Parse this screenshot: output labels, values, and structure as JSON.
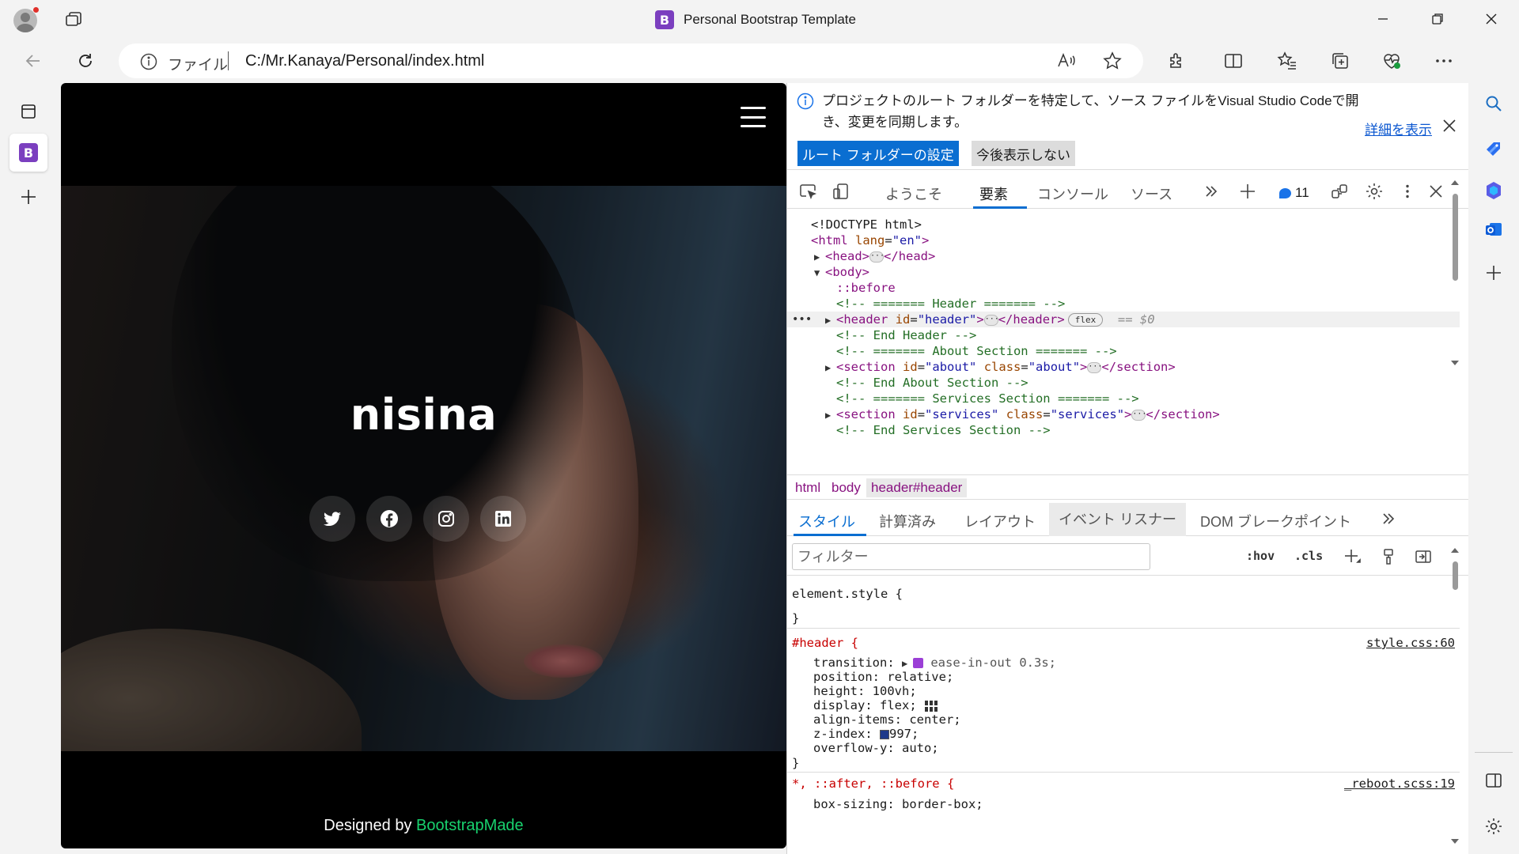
{
  "browser": {
    "tab_title": "Personal Bootstrap Template",
    "tab_logo_letter": "B",
    "address": {
      "scheme_label": "ファイル",
      "url": "C:/Mr.Kanaya/Personal/index.html"
    }
  },
  "page": {
    "site_name": "nisina",
    "socials": [
      "twitter-icon",
      "facebook-icon",
      "instagram-icon",
      "linkedin-icon"
    ],
    "credits_prefix": "Designed by",
    "credits_link": "BootstrapMade",
    "credits_link_color": "#18d26e"
  },
  "devtools": {
    "banner": {
      "message": "プロジェクトのルート フォルダーを特定して、ソース ファイルをVisual Studio Codeで開き、変更を同期します。",
      "learn_more": "詳細を表示",
      "primary_button": "ルート フォルダーの設定",
      "secondary_button": "今後表示しない"
    },
    "tabs": [
      "ようこそ",
      "要素",
      "コンソール",
      "ソース"
    ],
    "issues_count": "11",
    "dom": {
      "doctype": "<!DOCTYPE html>",
      "html_open": "html",
      "lang_attr": "lang",
      "lang_val": "\"en\"",
      "head_tag": "head",
      "body_tag": "body",
      "before": "::before",
      "c1": "<!-- ======= Header ======= -->",
      "header_tag": "header",
      "id_attr": "id",
      "header_id": "\"header\"",
      "flex_badge": "flex",
      "eq0": "== $0",
      "c2": "<!-- End Header -->",
      "c3": "<!-- ======= About Section ======= -->",
      "section_tag": "section",
      "class_attr": "class",
      "about_id": "\"about\"",
      "about_class": "\"about\"",
      "c4": "<!-- End About Section -->",
      "c5": "<!-- ======= Services Section ======= -->",
      "services_id": "\"services\"",
      "services_class": "\"services\"",
      "c6": "<!-- End Services Section -->"
    },
    "breadcrumbs": [
      "html",
      "body",
      "header#header"
    ],
    "sub_tabs": [
      "スタイル",
      "計算済み",
      "レイアウト",
      "イベント リスナー",
      "DOM ブレークポイント"
    ],
    "filter_placeholder": "フィルター",
    "hov_label": ":hov",
    "cls_label": ".cls",
    "styles": {
      "element_style": "element.style {",
      "close_brace": "}",
      "header_selector": "#header {",
      "header_src": "style.css:60",
      "transition_name": "transition",
      "transition_val": "ease-in-out 0.3s;",
      "position": "position: relative;",
      "height": "height: 100vh;",
      "display": "display: flex;",
      "align": "align-items: center;",
      "zindex_name": "z-index:",
      "zindex_val": "997;",
      "overflow": "overflow-y: auto;",
      "univ_selector": "*, ::after, ::before {",
      "univ_src": "_reboot.scss:19",
      "box_sizing": "box-sizing: border-box;"
    }
  }
}
